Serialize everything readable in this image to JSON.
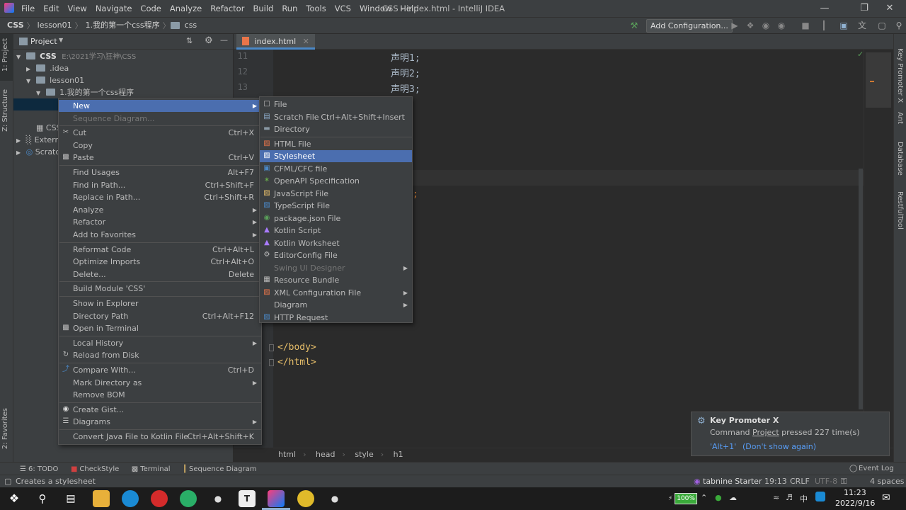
{
  "title_bar": {
    "menus": [
      "File",
      "Edit",
      "View",
      "Navigate",
      "Code",
      "Analyze",
      "Refactor",
      "Build",
      "Run",
      "Tools",
      "VCS",
      "Window",
      "Help"
    ],
    "window_title": "CSS - index.html - IntelliJ IDEA"
  },
  "nav_bar": {
    "breadcrumbs": [
      "CSS",
      "lesson01",
      "1.我的第一个css程序",
      "css"
    ],
    "add_configuration": "Add Configuration..."
  },
  "left_strip": {
    "project_tab": "1: Project",
    "structure_tab": "Z: Structure",
    "favorites_tab": "2: Favorites"
  },
  "right_strip": {
    "tabs": [
      "Key Promoter X",
      "Ant",
      "Database",
      "RestfulTool"
    ]
  },
  "project_panel": {
    "header": "Project",
    "tree": [
      {
        "label": "CSS",
        "extra": "E:\\2021学习\\狂神\\CSS"
      },
      {
        "label": ".idea"
      },
      {
        "label": "lesson01"
      },
      {
        "label": "1.我的第一个css程序"
      },
      {
        "label": "CSS"
      },
      {
        "label": "Externa"
      },
      {
        "label": "Scratc"
      }
    ]
  },
  "editor": {
    "tab_label": "index.html",
    "line_numbers": [
      "11",
      "12",
      "13"
    ],
    "lines_top": [
      "声明1;",
      "声明2;",
      "声明3;"
    ],
    "semicolon": ";",
    "closing_lines": [
      "</body>",
      "</html>"
    ],
    "breadcrumbs": [
      "html",
      "head",
      "style",
      "h1"
    ]
  },
  "context_menu": {
    "items": [
      {
        "label": "New",
        "shortcut": "",
        "submenu": true,
        "highlight": true
      },
      {
        "label": "Sequence Diagram...",
        "disabled": true
      },
      {
        "label": "Cut",
        "shortcut": "Ctrl+X",
        "icon": "cut-icon"
      },
      {
        "label": "Copy",
        "shortcut": ""
      },
      {
        "label": "Paste",
        "shortcut": "Ctrl+V",
        "icon": "paste-icon"
      },
      {
        "label": "Find Usages",
        "shortcut": "Alt+F7"
      },
      {
        "label": "Find in Path...",
        "shortcut": "Ctrl+Shift+F"
      },
      {
        "label": "Replace in Path...",
        "shortcut": "Ctrl+Shift+R"
      },
      {
        "label": "Analyze",
        "submenu": true
      },
      {
        "label": "Refactor",
        "submenu": true
      },
      {
        "label": "Add to Favorites",
        "submenu": true
      },
      {
        "label": "Reformat Code",
        "shortcut": "Ctrl+Alt+L"
      },
      {
        "label": "Optimize Imports",
        "shortcut": "Ctrl+Alt+O"
      },
      {
        "label": "Delete...",
        "shortcut": "Delete"
      },
      {
        "label": "Build Module 'CSS'"
      },
      {
        "label": "Show in Explorer"
      },
      {
        "label": "Directory Path",
        "shortcut": "Ctrl+Alt+F12"
      },
      {
        "label": "Open in Terminal",
        "icon": "terminal-icon"
      },
      {
        "label": "Local History",
        "submenu": true
      },
      {
        "label": "Reload from Disk",
        "icon": "reload-icon"
      },
      {
        "label": "Compare With...",
        "shortcut": "Ctrl+D",
        "icon": "compare-icon"
      },
      {
        "label": "Mark Directory as",
        "submenu": true
      },
      {
        "label": "Remove BOM"
      },
      {
        "label": "Create Gist...",
        "icon": "github-icon"
      },
      {
        "label": "Diagrams",
        "submenu": true,
        "icon": "diagram-icon"
      },
      {
        "label": "Convert Java File to Kotlin File",
        "shortcut": "Ctrl+Alt+Shift+K"
      }
    ]
  },
  "new_submenu": {
    "items": [
      {
        "label": "File",
        "icon": "file-icon"
      },
      {
        "label": "Scratch File",
        "shortcut": "Ctrl+Alt+Shift+Insert",
        "icon": "scratch-icon"
      },
      {
        "label": "Directory",
        "icon": "folder-icon"
      },
      {
        "label": "HTML File",
        "icon": "html-icon"
      },
      {
        "label": "Stylesheet",
        "icon": "css-icon",
        "highlight": true
      },
      {
        "label": "CFML/CFC file",
        "icon": "cfml-icon"
      },
      {
        "label": "OpenAPI Specification",
        "icon": "openapi-icon"
      },
      {
        "label": "JavaScript File",
        "icon": "js-icon"
      },
      {
        "label": "TypeScript File",
        "icon": "ts-icon"
      },
      {
        "label": "package.json File",
        "icon": "npm-icon"
      },
      {
        "label": "Kotlin Script",
        "icon": "kotlin-icon"
      },
      {
        "label": "Kotlin Worksheet",
        "icon": "kotlin-icon"
      },
      {
        "label": "EditorConfig File",
        "icon": "gear-icon"
      },
      {
        "label": "Swing UI Designer",
        "disabled": true,
        "submenu": true
      },
      {
        "label": "Resource Bundle",
        "icon": "bundle-icon"
      },
      {
        "label": "XML Configuration File",
        "submenu": true,
        "icon": "xml-icon"
      },
      {
        "label": "Diagram",
        "submenu": true
      },
      {
        "label": "HTTP Request",
        "icon": "http-icon"
      }
    ]
  },
  "notification": {
    "title": "Key Promoter X",
    "msg_prefix": "Command ",
    "msg_cmd": "Project",
    "msg_suffix": " pressed 227 time(s)",
    "shortcut_link": "'Alt+1'",
    "dismiss_link": "(Don't show again)"
  },
  "bottom_tools": [
    "6: TODO",
    "CheckStyle",
    "Terminal",
    "Sequence Diagram"
  ],
  "event_log": "Event Log",
  "status": {
    "message": "Creates a stylesheet",
    "tabnine": "tabnine Starter",
    "position": "19:13",
    "line_sep": "CRLF",
    "encoding": "UTF-8",
    "indent": "4 spaces"
  },
  "taskbar": {
    "battery": "100%",
    "lang": "中",
    "time": "11:23",
    "date": "2022/9/16"
  }
}
